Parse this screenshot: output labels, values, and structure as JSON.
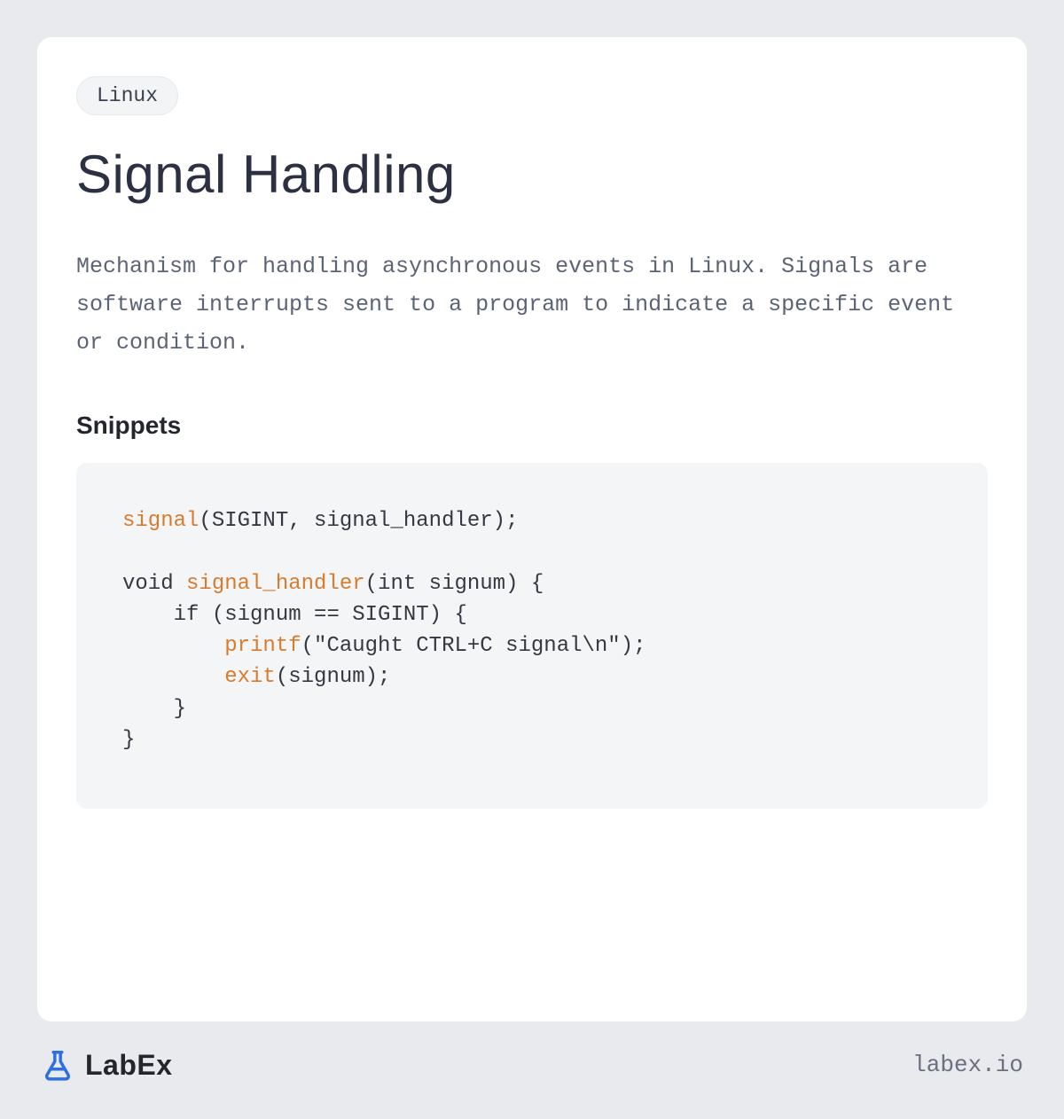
{
  "tag": "Linux",
  "title": "Signal Handling",
  "description": "Mechanism for handling asynchronous events in Linux. Signals are software interrupts sent to a program to indicate a specific event or condition.",
  "snippets_heading": "Snippets",
  "code": {
    "line1_fn": "signal",
    "line1_rest": "(SIGINT, signal_handler);",
    "line2_pre": "void ",
    "line2_fn": "signal_handler",
    "line2_rest": "(int signum) {",
    "line3": "    if (signum == SIGINT) {",
    "line4_pre": "        ",
    "line4_fn": "printf",
    "line4_rest": "(\"Caught CTRL+C signal\\n\");",
    "line5_pre": "        ",
    "line5_fn": "exit",
    "line5_rest": "(signum);",
    "line6": "    }",
    "line7": "}"
  },
  "brand": {
    "name": "LabEx",
    "domain": "labex.io"
  }
}
